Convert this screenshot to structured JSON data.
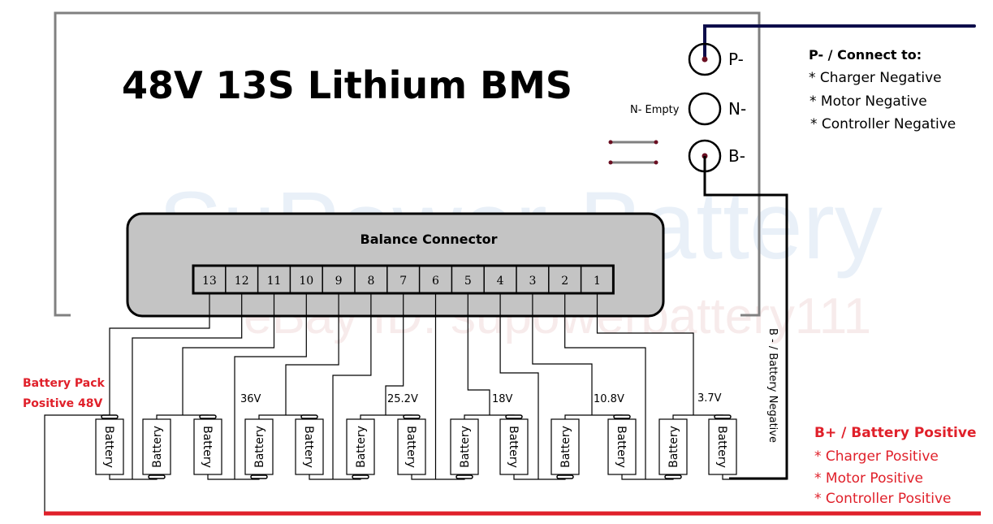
{
  "title": "48V  13S  Lithium BMS",
  "watermark": {
    "brand": "SuPower-Battery",
    "ebay": "eBay ID:  supowerbattery111"
  },
  "balance_connector": {
    "label": "Balance Connector",
    "pins": [
      "13",
      "12",
      "11",
      "10",
      "9",
      "8",
      "7",
      "6",
      "5",
      "4",
      "3",
      "2",
      "1"
    ]
  },
  "terminals": [
    {
      "id": "p-minus",
      "label": "P-",
      "wired": true
    },
    {
      "id": "n-minus",
      "label": "N-",
      "wired": false,
      "note": "N- Empty"
    },
    {
      "id": "b-minus",
      "label": "B-",
      "wired": true
    }
  ],
  "p_minus_info": {
    "heading": "P- / Connect to:",
    "items": [
      "* Charger Negative",
      "* Motor Negative",
      "* Controller Negative"
    ]
  },
  "b_plus_info": {
    "heading": "B+ / Battery Positive",
    "items": [
      "* Charger Positive",
      "* Motor Positive",
      "* Controller Positive"
    ]
  },
  "battery_negative_label": "B - / Battery Negative",
  "pack_positive_label": [
    "Battery Pack",
    "Positive 48V"
  ],
  "battery_label": "Battery",
  "battery_count": 13,
  "voltage_taps": [
    "36V",
    "25.2V",
    "18V",
    "10.8V",
    "3.7V"
  ],
  "colors": {
    "positive": "#e0202a",
    "p_minus_wire": "#0d0d4a",
    "frame": "#808080",
    "connector_fill": "#c4c4c4",
    "terminal_dot": "#6a0f22"
  }
}
